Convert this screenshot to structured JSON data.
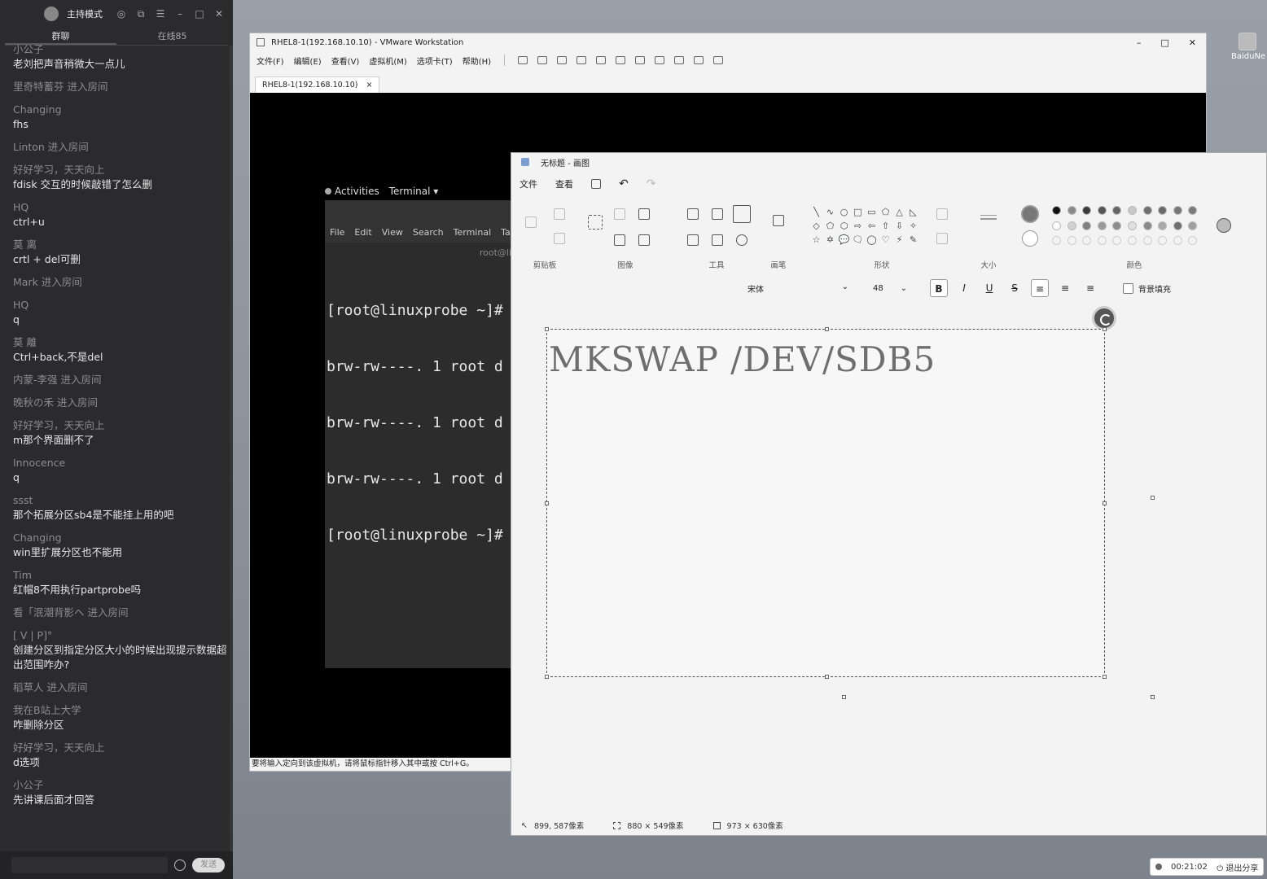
{
  "chat": {
    "title": "主持模式",
    "tabs": [
      "群聊",
      "在线85"
    ],
    "messages": [
      {
        "name": "小公子",
        "text": "老刘把声音稍微大一点儿"
      },
      {
        "name": "里奇特蓄芬 进入房间",
        "text": ""
      },
      {
        "name": "Changing",
        "text": "fhs"
      },
      {
        "name": "Linton 进入房间",
        "text": ""
      },
      {
        "name": "好好学习，天天向上",
        "text": "fdisk 交互的时候敲错了怎么删"
      },
      {
        "name": "HQ",
        "text": "ctrl+u"
      },
      {
        "name": "莫 离",
        "text": "crtl + del可删"
      },
      {
        "name": "Mark 进入房间",
        "text": ""
      },
      {
        "name": "HQ",
        "text": "q"
      },
      {
        "name": "莫 離",
        "text": "Ctrl+back,不是del"
      },
      {
        "name": "内蒙-李强 进入房间",
        "text": ""
      },
      {
        "name": "晚秋の禾 进入房间",
        "text": ""
      },
      {
        "name": "好好学习，天天向上",
        "text": "m那个界面删不了"
      },
      {
        "name": "Innocence",
        "text": "q"
      },
      {
        "name": "ssst",
        "text": "那个拓展分区sb4是不能挂上用的吧"
      },
      {
        "name": "Changing",
        "text": "win里扩展分区也不能用"
      },
      {
        "name": "Tim",
        "text": "红帽8不用执行partprobe吗"
      },
      {
        "name": "看「泯潮背影ヘ 进入房间",
        "text": ""
      },
      {
        "name": "[ V | P]°",
        "text": "创建分区到指定分区大小的时候出现提示数据超出范围咋办?"
      },
      {
        "name": "稻草人 进入房间",
        "text": ""
      },
      {
        "name": "我在B站上大学",
        "text": "咋删除分区"
      },
      {
        "name": "好好学习，天天向上",
        "text": "d选项"
      },
      {
        "name": "小公子",
        "text": "先讲课后面才回答"
      }
    ],
    "send_label": "发送"
  },
  "desktop": {
    "icon_label": "BaiduNe"
  },
  "vmware": {
    "title": "RHEL8-1(192.168.10.10) - VMware Workstation",
    "menus": [
      "文件(F)",
      "编辑(E)",
      "查看(V)",
      "虚拟机(M)",
      "选项卡(T)",
      "帮助(H)"
    ],
    "tab_label": "RHEL8-1(192.168.10.10)",
    "status_text": "要将输入定向到该虚拟机，请将鼠标指针移入其中或按 Ctrl+G。",
    "guest": {
      "activities": "Activities",
      "app_menu": "Terminal ▾",
      "terminal_menus": [
        "File",
        "Edit",
        "View",
        "Search",
        "Terminal",
        "Tabs"
      ],
      "host_label": "root@lin",
      "lines": [
        "[root@linuxprobe ~]#",
        "brw-rw----. 1 root d",
        "brw-rw----. 1 root d",
        "brw-rw----. 1 root d",
        "[root@linuxprobe ~]#"
      ]
    }
  },
  "paint": {
    "title": "无标题 - 画图",
    "menus": {
      "file": "文件",
      "view": "查看"
    },
    "groups": {
      "clipboard": "剪贴板",
      "image": "图像",
      "tools": "工具",
      "brushes": "画笔",
      "shapes": "形状",
      "size": "大小",
      "colors": "颜色"
    },
    "shapes": [
      "╲",
      "∿",
      "○",
      "□",
      "▭",
      "⬠",
      "△",
      "◺",
      "◇",
      "⬠",
      "⬡",
      "⇨",
      "⇦",
      "⇧",
      "⇩",
      "✧",
      "☆",
      "✡",
      "💬",
      "🗨",
      "◯",
      "♡",
      "⚡",
      "✎"
    ],
    "colors_row1": [
      "#111111",
      "#8a8a8a",
      "#3a3a3a",
      "#555555",
      "#666666",
      "#c8c8c8",
      "#707070",
      "#6a6a6a",
      "#777777",
      "#7a7a7a"
    ],
    "colors_row2": [
      "#ffffff",
      "#d0d0d0",
      "#808080",
      "#9a9a9a",
      "#8c8c8c",
      "#e0e0e0",
      "#8a8a8a",
      "#a8a8a8",
      "#6e6e6e",
      "#a0a0a0"
    ],
    "text_toolbar": {
      "font": "宋体",
      "size": "48",
      "bold": "B",
      "italic": "I",
      "underline": "U",
      "strike": "S",
      "fill_label": "背景填充"
    },
    "canvas_text": "MKSWAP /DEV/SDB5",
    "status": {
      "cursor": "899, 587像素",
      "selection": "880 × 549像素",
      "canvas_size": "973 × 630像素"
    }
  },
  "recorder": {
    "time": "00:21:02",
    "exit_label": "退出分享"
  }
}
